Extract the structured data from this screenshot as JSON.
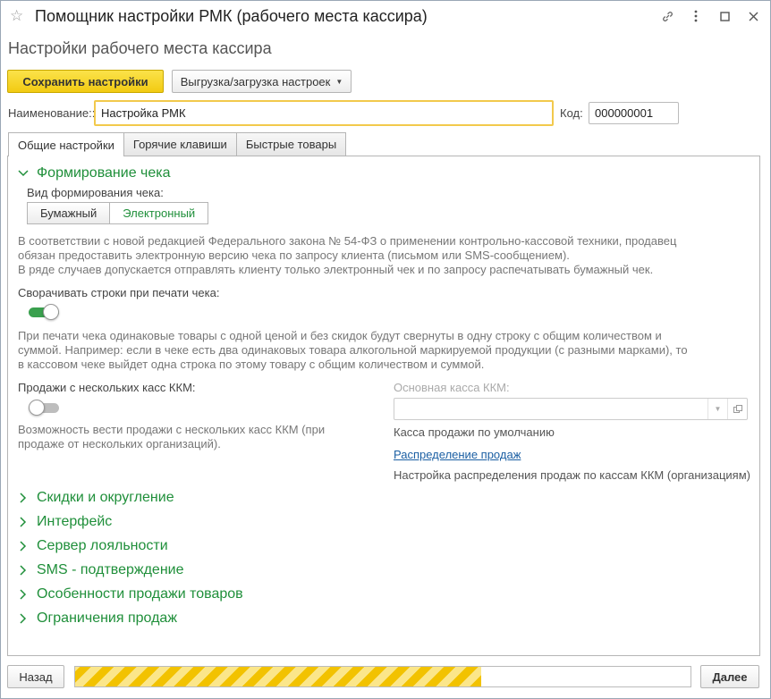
{
  "window": {
    "title": "Помощник настройки РМК (рабочего места кассира)",
    "subtitle": "Настройки рабочего места кассира"
  },
  "toolbar": {
    "save_label": "Сохранить настройки",
    "export_label": "Выгрузка/загрузка настроек"
  },
  "form": {
    "name_label": "Наименование::",
    "name_value": "Настройка РМК",
    "code_label": "Код:",
    "code_value": "000000001"
  },
  "tabs": [
    {
      "label": "Общие настройки",
      "active": true
    },
    {
      "label": "Горячие клавиши",
      "active": false
    },
    {
      "label": "Быстрые товары",
      "active": false
    }
  ],
  "receipt_group": {
    "title": "Формирование чека",
    "type_label": "Вид формирования чека:",
    "options": [
      "Бумажный",
      "Электронный"
    ],
    "selected": "Электронный",
    "info_lines": [
      "В соответствии с новой редакцией Федерального закона № 54-ФЗ о применении контрольно-кассовой техники, продавец",
      "обязан предоставить электронную версию чека по запросу клиента (письмом или SMS-сообщением).",
      "В ряде случаев допускается отправлять клиенту только электронный чек и по запросу  распечатывать бумажный чек."
    ],
    "collapse_label": "Сворачивать строки при печати чека:",
    "collapse_on": true,
    "collapse_hint_lines": [
      "При печати чека одинаковые товары с одной ценой и без скидок будут свернуты в одну строку с общим количеством и",
      "суммой. Например: если в чеке есть два одинаковых товара алкогольной маркируемой продукции (с разными марками), то",
      "в кассовом чеке выйдет одна строка по этому товару с общим количеством и суммой."
    ],
    "multi_label": "Продажи с нескольких касс ККМ:",
    "multi_on": false,
    "multi_hint_lines": [
      "Возможность вести продажи с нескольких касс ККМ (при",
      "продаже от нескольких организаций)."
    ],
    "main_kkm_label": "Основная касса ККМ:",
    "main_kkm_value": "",
    "main_kkm_hint": "Касса продажи по умолчанию",
    "distribution_link": "Распределение продаж",
    "distribution_hint": "Настройка распределения продаж по кассам ККМ (организациям)"
  },
  "collapsed_groups": [
    "Скидки и округление",
    "Интерфейс",
    "Сервер лояльности",
    "SMS - подтверждение",
    "Особенности продажи товаров",
    "Ограничения продаж"
  ],
  "footer": {
    "back_label": "Назад",
    "next_label": "Далее",
    "progress": 0.66
  },
  "colors": {
    "accent_green": "#1f8f3a",
    "primary_yellow": "#f2cb12",
    "link_blue": "#1b5fa3"
  }
}
